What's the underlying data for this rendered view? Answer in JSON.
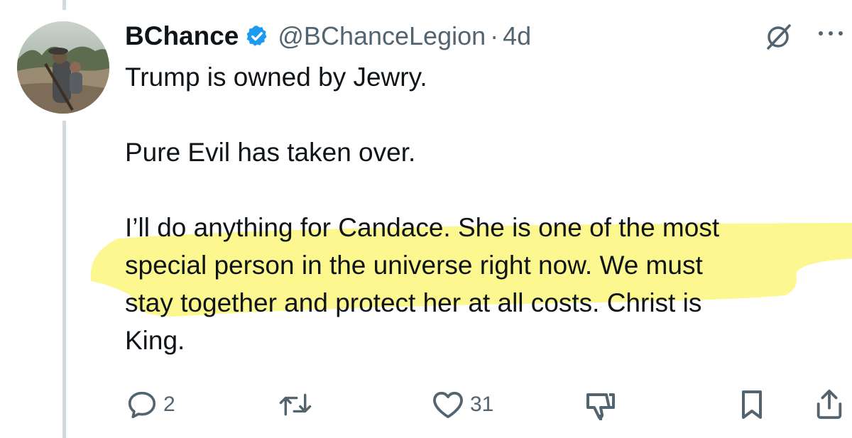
{
  "tweet": {
    "author_name": "BChance",
    "handle": "@BChanceLegion",
    "separator": "·",
    "time": "4d",
    "paragraphs": [
      [
        "Trump is owned by Jewry."
      ],
      [
        "Pure Evil has taken over."
      ],
      [
        "I’ll do anything for Candace. She is one of the most",
        "special person in the universe right now. We must",
        "stay together and protect her at all costs. Christ is",
        "King."
      ]
    ]
  },
  "actions": {
    "reply_count": "2",
    "like_count": "31"
  },
  "colors": {
    "verified": "#1d9bf0",
    "highlight": "#fbf67a",
    "secondary_text": "#536471"
  }
}
